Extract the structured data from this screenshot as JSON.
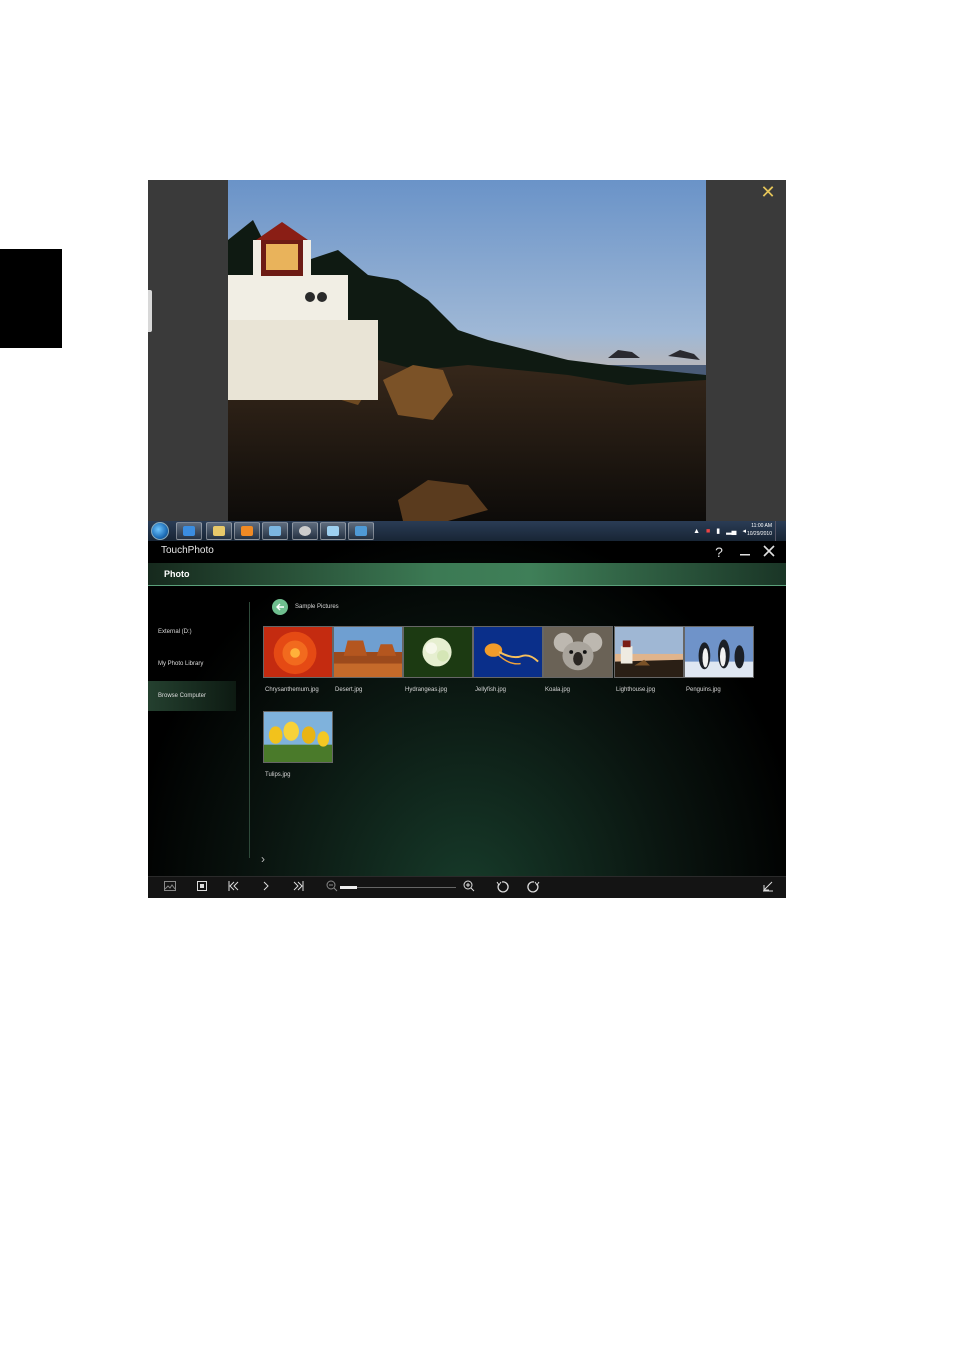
{
  "viewer": {
    "close_icon": "close-icon",
    "accent": "#e6c65a"
  },
  "taskbar": {
    "start_icon": "windows-start-icon",
    "pinned_icons": [
      "internet-explorer-icon",
      "folder-icon",
      "media-player-icon",
      "paint-icon",
      "disc-icon",
      "notepad-icon",
      "photo-icon"
    ],
    "clock_time": "11:00 AM",
    "clock_date": "10/29/2010"
  },
  "app": {
    "title": "TouchPhoto",
    "help_label": "?",
    "menu": {
      "photo_label": "Photo"
    },
    "sidebar": {
      "items": [
        {
          "label": "External (D:)"
        },
        {
          "label": "My Photo Library"
        },
        {
          "label": "Browse Computer"
        }
      ]
    },
    "breadcrumb": {
      "label": "Sample Pictures"
    },
    "thumbnails": [
      {
        "caption": "Chrysanthemum.jpg"
      },
      {
        "caption": "Desert.jpg"
      },
      {
        "caption": "Hydrangeas.jpg"
      },
      {
        "caption": "Jellyfish.jpg"
      },
      {
        "caption": "Koala.jpg"
      },
      {
        "caption": "Lighthouse.jpg"
      },
      {
        "caption": "Penguins.jpg"
      },
      {
        "caption": "Tulips.jpg"
      }
    ],
    "toolbar": {
      "zoom_level": 0.15
    }
  }
}
